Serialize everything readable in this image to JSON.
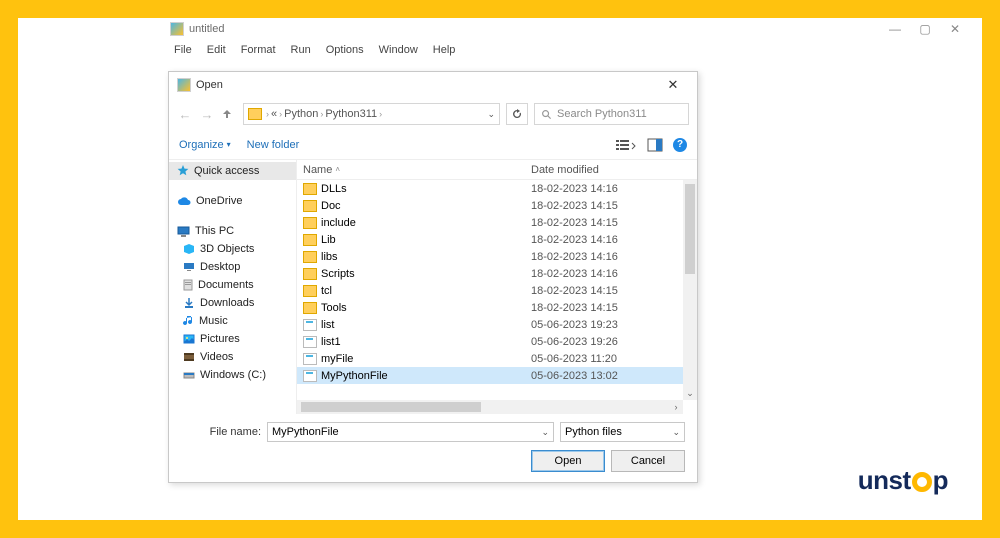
{
  "parent": {
    "title": "untitled",
    "menu": [
      "File",
      "Edit",
      "Format",
      "Run",
      "Options",
      "Window",
      "Help"
    ]
  },
  "dialog": {
    "title": "Open",
    "breadcrumb": {
      "seg1": "Python",
      "seg2": "Python311"
    },
    "search_placeholder": "Search Python311",
    "toolbar": {
      "organize": "Organize",
      "new_folder": "New folder"
    },
    "columns": {
      "name": "Name",
      "date": "Date modified"
    },
    "sidebar": {
      "quick": "Quick access",
      "onedrive": "OneDrive",
      "thispc": "This PC",
      "items": [
        "3D Objects",
        "Desktop",
        "Documents",
        "Downloads",
        "Music",
        "Pictures",
        "Videos",
        "Windows (C:)"
      ]
    },
    "rows": [
      {
        "type": "fld",
        "name": "DLLs",
        "date": "18-02-2023 14:16"
      },
      {
        "type": "fld",
        "name": "Doc",
        "date": "18-02-2023 14:15"
      },
      {
        "type": "fld",
        "name": "include",
        "date": "18-02-2023 14:15"
      },
      {
        "type": "fld",
        "name": "Lib",
        "date": "18-02-2023 14:16"
      },
      {
        "type": "fld",
        "name": "libs",
        "date": "18-02-2023 14:16"
      },
      {
        "type": "fld",
        "name": "Scripts",
        "date": "18-02-2023 14:16"
      },
      {
        "type": "fld",
        "name": "tcl",
        "date": "18-02-2023 14:15"
      },
      {
        "type": "fld",
        "name": "Tools",
        "date": "18-02-2023 14:15"
      },
      {
        "type": "fil",
        "name": "list",
        "date": "05-06-2023 19:23"
      },
      {
        "type": "fil",
        "name": "list1",
        "date": "05-06-2023 19:26"
      },
      {
        "type": "fil",
        "name": "myFile",
        "date": "05-06-2023 11:20"
      },
      {
        "type": "fil",
        "name": "MyPythonFile",
        "date": "05-06-2023 13:02",
        "selected": true
      }
    ],
    "filename_label": "File name:",
    "filename_value": "MyPythonFile",
    "filter": "Python files",
    "open_btn": "Open",
    "cancel_btn": "Cancel"
  },
  "brand": {
    "pre": "unst",
    "post": "p"
  }
}
